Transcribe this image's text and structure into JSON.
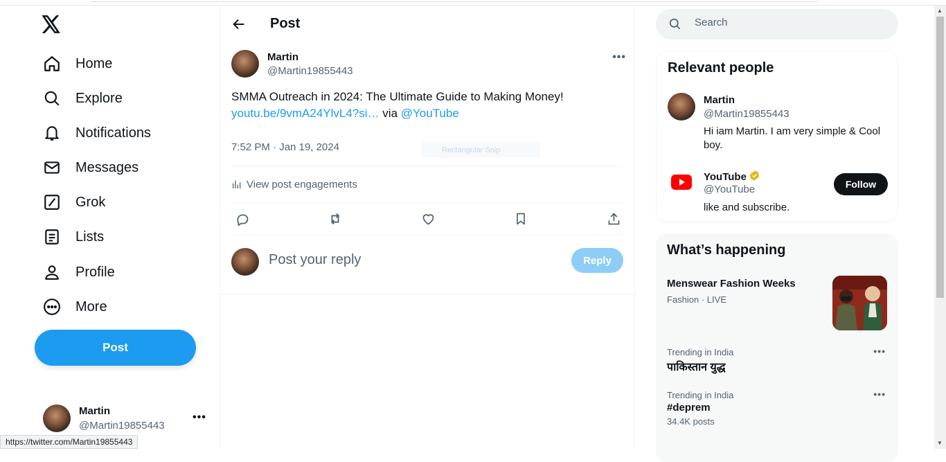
{
  "nav": {
    "items": [
      {
        "label": "Home",
        "icon": "home-icon"
      },
      {
        "label": "Explore",
        "icon": "search-icon"
      },
      {
        "label": "Notifications",
        "icon": "bell-icon"
      },
      {
        "label": "Messages",
        "icon": "envelope-icon"
      },
      {
        "label": "Grok",
        "icon": "grok-icon"
      },
      {
        "label": "Lists",
        "icon": "list-icon"
      },
      {
        "label": "Profile",
        "icon": "person-icon"
      },
      {
        "label": "More",
        "icon": "more-circle-icon"
      }
    ],
    "post_button": "Post",
    "account": {
      "name": "Martin",
      "handle": "@Martin19855443"
    }
  },
  "status_url": "https://twitter.com/Martin19855443",
  "header": {
    "title": "Post"
  },
  "tweet": {
    "author_name": "Martin",
    "author_handle": "@Martin19855443",
    "text": "SMMA Outreach in 2024: The Ultimate Guide to Making Money!",
    "link": "youtu.be/9vmA24YlvL4?si…",
    "via": "via",
    "mention": "@YouTube",
    "timestamp": "7:52 PM · Jan 19, 2024",
    "ghost_overlay": "Rectangular Snip",
    "engagements": "View post engagements"
  },
  "reply": {
    "placeholder": "Post your reply",
    "button": "Reply"
  },
  "search": {
    "placeholder": "Search"
  },
  "relevant": {
    "title": "Relevant people",
    "people": [
      {
        "name": "Martin",
        "handle": "@Martin19855443",
        "bio": "Hi iam Martin. I am very simple & Cool boy."
      },
      {
        "name": "YouTube",
        "handle": "@YouTube",
        "bio": "like and subscribe.",
        "follow": "Follow",
        "verified": true
      }
    ]
  },
  "happening": {
    "title": "What’s happening",
    "trends": [
      {
        "title": "Menswear Fashion Weeks",
        "context": "Fashion · LIVE"
      },
      {
        "context": "Trending in India",
        "title": "पाकिस्तान युद्ध"
      },
      {
        "context": "Trending in India",
        "title": "#deprem",
        "count": "34.4K posts"
      }
    ]
  },
  "colors": {
    "accent": "#1d9bf0",
    "text": "#0f1419",
    "muted": "#536471",
    "youtube": "#ff0000",
    "gold_badge": "#e2b719"
  }
}
